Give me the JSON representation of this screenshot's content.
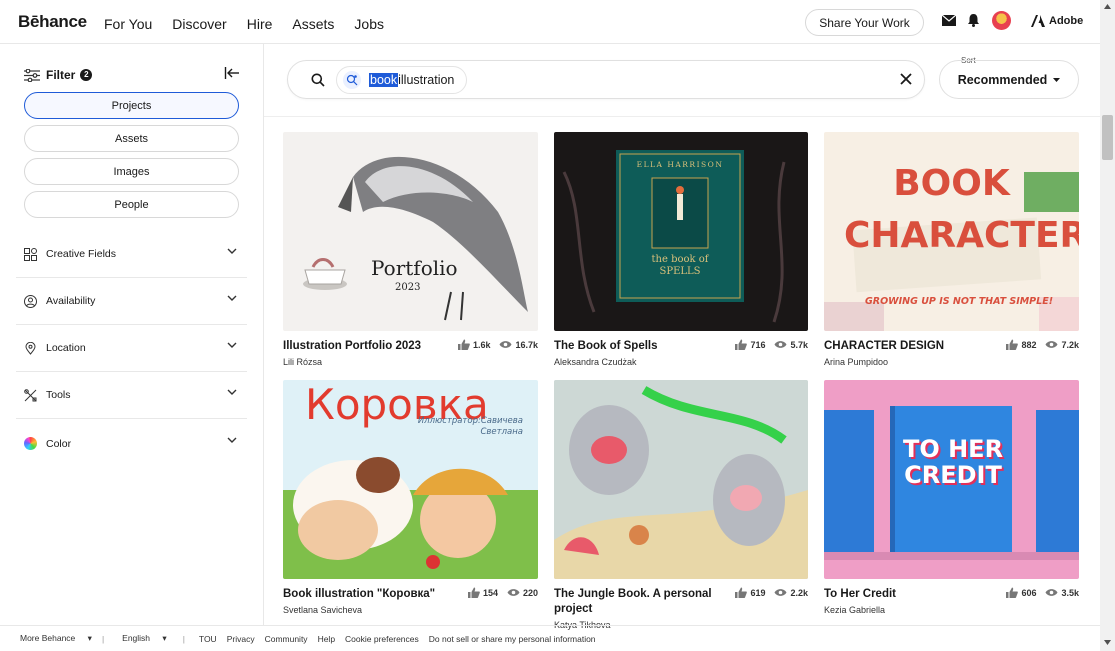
{
  "header": {
    "logo": "Bēhance",
    "nav": [
      "For You",
      "Discover",
      "Hire",
      "Assets",
      "Jobs"
    ],
    "share_label": "Share Your Work",
    "adobe_label": "Adobe",
    "icons": [
      "mail-icon",
      "bell-icon",
      "avatar",
      "adobe-logo-icon"
    ]
  },
  "sidebar": {
    "filter_label": "Filter",
    "filter_count": "2",
    "types": [
      "Projects",
      "Assets",
      "Images",
      "People"
    ],
    "active_type": "Projects",
    "sections": [
      {
        "label": "Creative Fields",
        "icon": "grid-icon"
      },
      {
        "label": "Availability",
        "icon": "person-icon"
      },
      {
        "label": "Location",
        "icon": "location-pin-icon"
      },
      {
        "label": "Tools",
        "icon": "tools-icon"
      },
      {
        "label": "Color",
        "icon": "color-wheel-icon"
      }
    ]
  },
  "search": {
    "highlighted": "book",
    "rest": " illustration",
    "sort_label": "Sort",
    "sort_value": "Recommended"
  },
  "projects": [
    {
      "title": "Illustration Portfolio 2023",
      "owner": "Lili Rózsa",
      "likes": "1.6k",
      "views": "16.7k",
      "thumb_text": "Portfolio",
      "thumb_sub": "2023"
    },
    {
      "title": "The Book of Spells",
      "owner": "Aleksandra Czudżak",
      "likes": "716",
      "views": "5.7k",
      "thumb_text": "the book of SPELLS",
      "thumb_sub": "ELLA HARRISON"
    },
    {
      "title": "CHARACTER DESIGN",
      "owner": "Arina Pumpidoo",
      "likes": "882",
      "views": "7.2k",
      "thumb_text": "BOOK CHARACTERS",
      "thumb_sub": "GROWING UP IS NOT THAT SIMPLE!"
    },
    {
      "title": "Book illustration \"Коровка\"",
      "owner": "Svetlana Savicheva",
      "likes": "154",
      "views": "220",
      "thumb_text": "Коровка",
      "thumb_sub": "Иллюстратор:Савичева Светлана"
    },
    {
      "title": "The Jungle Book. A personal project",
      "owner": "Katya Tikhova",
      "likes": "619",
      "views": "2.2k",
      "thumb_text": "",
      "thumb_sub": ""
    },
    {
      "title": "To Her Credit",
      "owner": "Kezia Gabriella",
      "likes": "606",
      "views": "3.5k",
      "thumb_text": "TO HER CREDIT",
      "thumb_sub": ""
    }
  ],
  "footer": {
    "more": "More Behance",
    "language": "English",
    "links": [
      "TOU",
      "Privacy",
      "Community",
      "Help",
      "Cookie preferences",
      "Do not sell or share my personal information"
    ]
  }
}
